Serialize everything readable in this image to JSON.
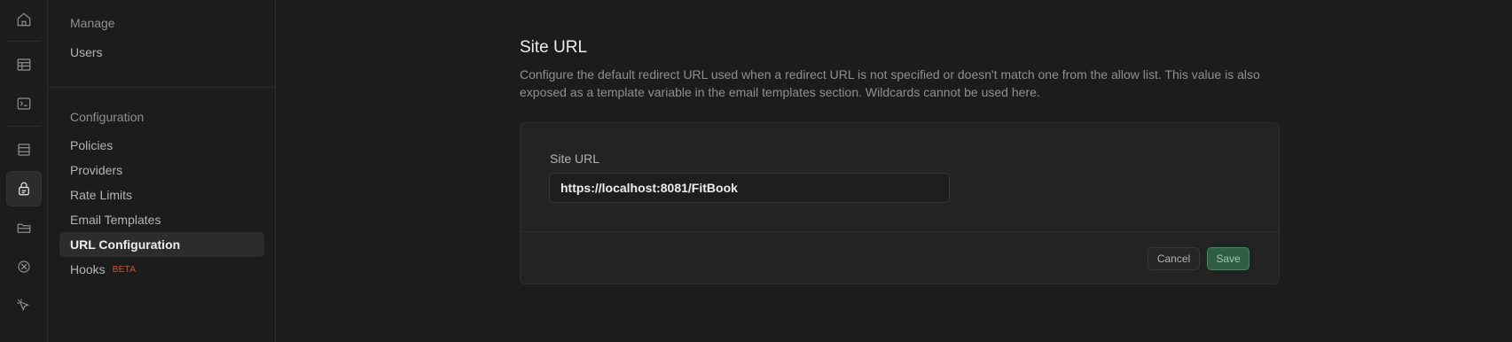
{
  "rail": {
    "icons": [
      "home-icon",
      "table-icon",
      "terminal-icon",
      "database-icon",
      "auth-icon",
      "storage-icon",
      "realtime-icon",
      "edge-functions-icon"
    ]
  },
  "sidebar": {
    "manage_title": "Manage",
    "manage_items": [
      {
        "label": "Users"
      }
    ],
    "config_title": "Configuration",
    "config_items": [
      {
        "label": "Policies"
      },
      {
        "label": "Providers"
      },
      {
        "label": "Rate Limits"
      },
      {
        "label": "Email Templates"
      },
      {
        "label": "URL Configuration",
        "active": true
      },
      {
        "label": "Hooks",
        "badge": "BETA"
      }
    ]
  },
  "main": {
    "title": "Site URL",
    "description": "Configure the default redirect URL used when a redirect URL is not specified or doesn't match one from the allow list. This value is also exposed as a template variable in the email templates section. Wildcards cannot be used here.",
    "field_label": "Site URL",
    "field_value": "https://localhost:8081/FitBook",
    "cancel_label": "Cancel",
    "save_label": "Save"
  },
  "colors": {
    "background": "#1c1c1c",
    "accent_green": "#2e5d43",
    "badge_orange": "#d4562d"
  }
}
